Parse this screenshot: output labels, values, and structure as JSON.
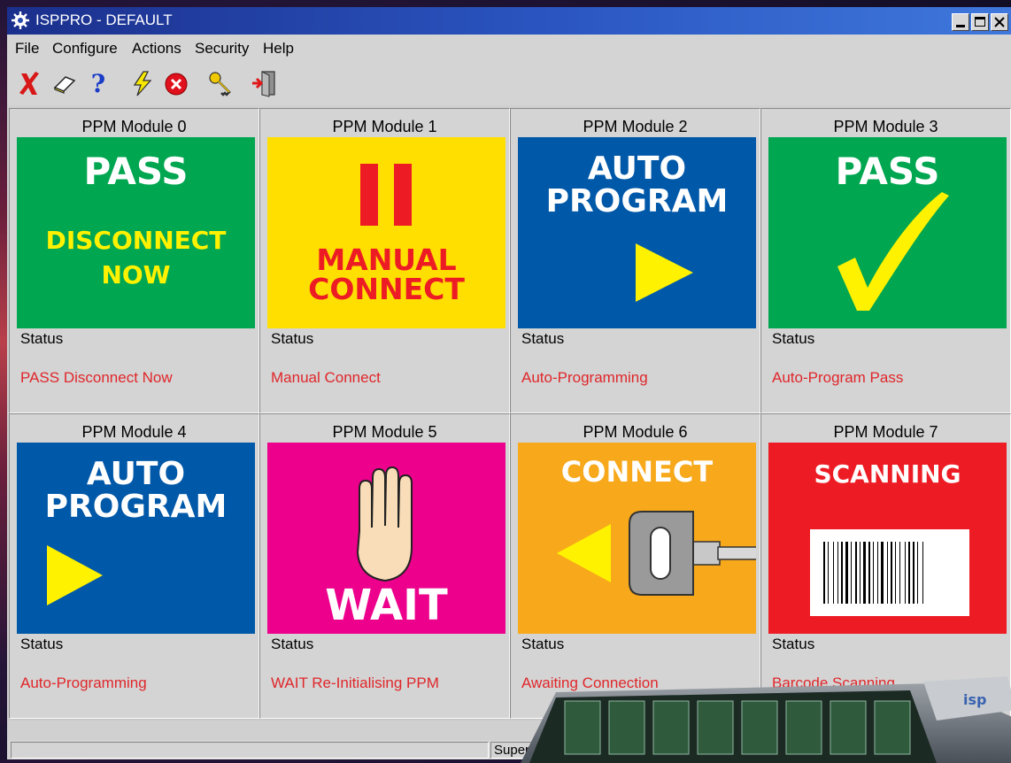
{
  "window": {
    "title": "ISPPRO - DEFAULT"
  },
  "menu": [
    "File",
    "Configure",
    "Actions",
    "Security",
    "Help"
  ],
  "toolbar_icons": [
    "red-x-icon",
    "eraser-icon",
    "help-icon",
    "lightning-icon",
    "stop-icon",
    "keys-icon",
    "exit-door-icon"
  ],
  "status_label": "Status",
  "modules": [
    {
      "title": "PPM Module 0",
      "panel": {
        "color": "#00a650",
        "lines": [
          "PASS",
          "DISCONNECT",
          "NOW"
        ]
      },
      "status": "PASS Disconnect Now"
    },
    {
      "title": "PPM Module 1",
      "panel": {
        "color": "#ffdf00",
        "lines": [
          "MANUAL",
          "CONNECT"
        ]
      },
      "status": "Manual Connect"
    },
    {
      "title": "PPM Module 2",
      "panel": {
        "color": "#0058a8",
        "lines": [
          "AUTO",
          "PROGRAM"
        ]
      },
      "status": "Auto-Programming"
    },
    {
      "title": "PPM Module 3",
      "panel": {
        "color": "#00a650",
        "lines": [
          "PASS"
        ]
      },
      "status": "Auto-Program Pass"
    },
    {
      "title": "PPM Module 4",
      "panel": {
        "color": "#0058a8",
        "lines": [
          "AUTO",
          "PROGRAM"
        ]
      },
      "status": "Auto-Programming"
    },
    {
      "title": "PPM Module 5",
      "panel": {
        "color": "#ec008c",
        "lines": [
          "WAIT"
        ]
      },
      "status": "WAIT Re-Initialising PPM"
    },
    {
      "title": "PPM Module 6",
      "panel": {
        "color": "#f7a81b",
        "lines": [
          "CONNECT"
        ]
      },
      "status": "Awaiting Connection"
    },
    {
      "title": "PPM Module 7",
      "panel": {
        "color": "#ed1c24",
        "lines": [
          "SCANNING"
        ]
      },
      "status": "Barcode Scanning"
    }
  ],
  "statusbar": {
    "pane2": "Super"
  }
}
